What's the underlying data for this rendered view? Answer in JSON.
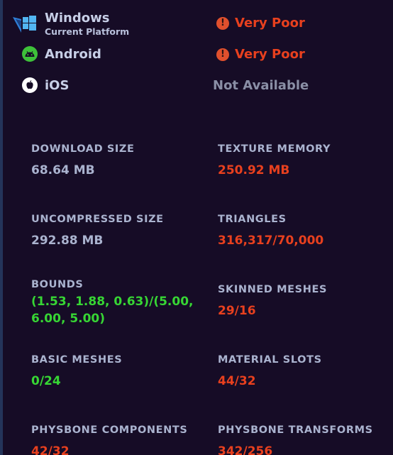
{
  "colors": {
    "background": "#160c26",
    "label": "#aab3cf",
    "bad": "#e8401e",
    "good": "#37d634",
    "not_available": "#8a8fa6"
  },
  "platforms": [
    {
      "name": "Windows",
      "subtitle": "Current Platform",
      "icon": "windows-icon",
      "rating": "Very Poor",
      "rating_icon": "warning-icon"
    },
    {
      "name": "Android",
      "icon": "android-icon",
      "rating": "Very Poor",
      "rating_icon": "warning-icon"
    },
    {
      "name": "iOS",
      "icon": "apple-icon",
      "rating": "Not Available"
    }
  ],
  "stats": {
    "download_size": {
      "label": "DOWNLOAD SIZE",
      "value": "68.64 MB"
    },
    "texture_memory": {
      "label": "TEXTURE MEMORY",
      "value": "250.92 MB"
    },
    "uncompressed_size": {
      "label": "UNCOMPRESSED SIZE",
      "value": "292.88 MB"
    },
    "triangles": {
      "label": "TRIANGLES",
      "value": "316,317/70,000"
    },
    "bounds": {
      "label": "BOUNDS",
      "value": "(1.53, 1.88, 0.63)/(5.00, 6.00, 5.00)"
    },
    "skinned_meshes": {
      "label": "SKINNED MESHES",
      "value": "29/16"
    },
    "basic_meshes": {
      "label": "BASIC MESHES",
      "value": "0/24"
    },
    "material_slots": {
      "label": "MATERIAL SLOTS",
      "value": "44/32"
    },
    "physbone_components": {
      "label": "PHYSBONE COMPONENTS",
      "value": "42/32"
    },
    "physbone_transforms": {
      "label": "PHYSBONE TRANSFORMS",
      "value": "342/256"
    }
  }
}
